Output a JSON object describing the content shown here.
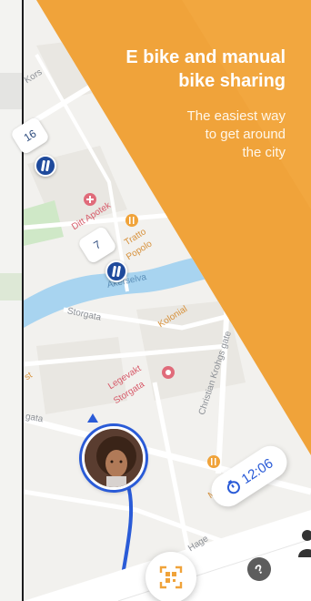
{
  "promo": {
    "title_line1": "E bike and manual",
    "title_line2": "bike sharing",
    "subtitle_line1": "The easiest way",
    "subtitle_line2": "to get around",
    "subtitle_line3": "the city"
  },
  "map": {
    "streets": {
      "kors": "Kors",
      "storgata_1": "Storgata",
      "storgata_2": "gata",
      "christian_krohgs_gate": "Christian Krohgs gate",
      "hage": "Hage"
    },
    "places": {
      "ditt_apotek": "Ditt Apotek",
      "trattoria_popolo_1": "Tratto",
      "trattoria_popolo_2": "Popolo",
      "akerselva": "Akerselva",
      "kolonial": "Kolonial",
      "legevakt_1": "Legevakt",
      "legevakt_2": "Storgata",
      "ma": "Ma",
      "st": "st"
    },
    "bike_counts": [
      {
        "value": "16"
      },
      {
        "value": "7"
      }
    ]
  },
  "ride": {
    "timer": "12:06"
  },
  "icons": {
    "bike_pin": "bike-station-icon",
    "timer": "stopwatch-icon",
    "scan": "qr-scan-icon",
    "help": "help-icon",
    "profile": "profile-icon",
    "pharmacy": "pharmacy-poi-icon",
    "restaurant": "restaurant-poi-icon",
    "hospital": "hospital-poi-icon",
    "location": "location-arrow-icon"
  },
  "colors": {
    "accent_orange": "#f0a33a",
    "brand_blue": "#1f4a9c",
    "route_blue": "#2a5bd7",
    "water": "#a8d4f0",
    "park": "#cfe8c7"
  }
}
